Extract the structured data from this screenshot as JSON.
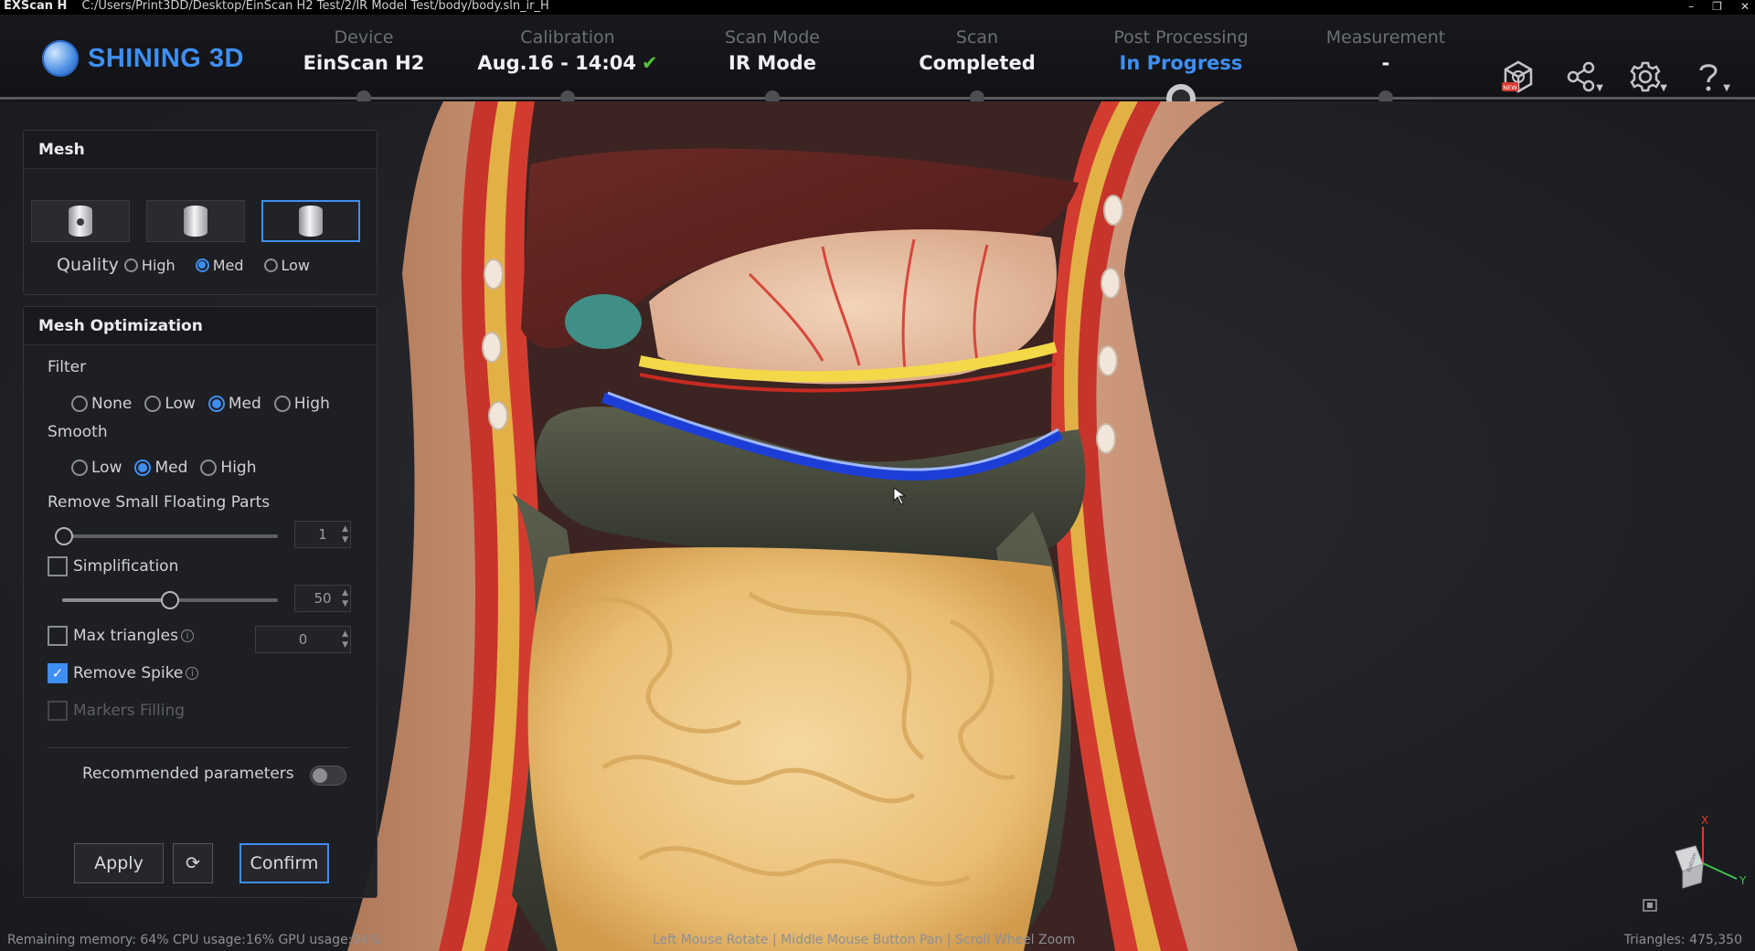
{
  "window": {
    "app_name": "EXScan H",
    "path": "C:/Users/Print3DD/Desktop/EinScan H2 Test/2/IR Model Test/body/body.sln_ir_H",
    "controls": [
      "–",
      "❐",
      "✕"
    ]
  },
  "logo": {
    "text": "SHINING 3D"
  },
  "workflow": [
    {
      "label": "Device",
      "value": "EinScan H2"
    },
    {
      "label": "Calibration",
      "value": "Aug.16 - 14:04",
      "check": "✔"
    },
    {
      "label": "Scan Mode",
      "value": "IR Mode"
    },
    {
      "label": "Scan",
      "value": "Completed"
    },
    {
      "label": "Post Processing",
      "value": "In Progress"
    },
    {
      "label": "Measurement",
      "value": "-"
    }
  ],
  "header_icons": [
    "3d-model-new-icon",
    "share-icon",
    "settings-icon",
    "help-icon"
  ],
  "new_badge": "NEW",
  "mesh_panel": {
    "title": "Mesh",
    "quality_label": "Quality",
    "quality_options": [
      "High",
      "Med",
      "Low"
    ],
    "quality_selected": "Med"
  },
  "mesh_opt": {
    "title": "Mesh Optimization",
    "filter_label": "Filter",
    "filter_options": [
      "None",
      "Low",
      "Med",
      "High"
    ],
    "filter_selected": "Med",
    "smooth_label": "Smooth",
    "smooth_options": [
      "Low",
      "Med",
      "High"
    ],
    "smooth_selected": "Med",
    "remove_small_label": "Remove Small Floating Parts",
    "remove_small_value": "1",
    "simplification_label": "Simplification",
    "simplification_value": "50",
    "max_triangles_label": "Max triangles",
    "max_triangles_value": "0",
    "remove_spike_label": "Remove Spike",
    "markers_filling_label": "Markers Filling",
    "recommended_label": "Recommended parameters",
    "apply_label": "Apply",
    "reset_symbol": "⟳",
    "confirm_label": "Confirm",
    "info_symbol": "i",
    "check_symbol": "✓"
  },
  "status": {
    "left": "Remaining memory: 64% CPU usage:16%  GPU usage:94%",
    "center": "Left Mouse Rotate | Middle Mouse Button  Pan | Scroll Wheel  Zoom",
    "right": "Triangles: 475,350"
  },
  "gizmo": {
    "x": "X",
    "y": "Y",
    "face": "Bottom"
  },
  "colors": {
    "accent": "#3f8ef3",
    "ok": "#53c23a"
  }
}
